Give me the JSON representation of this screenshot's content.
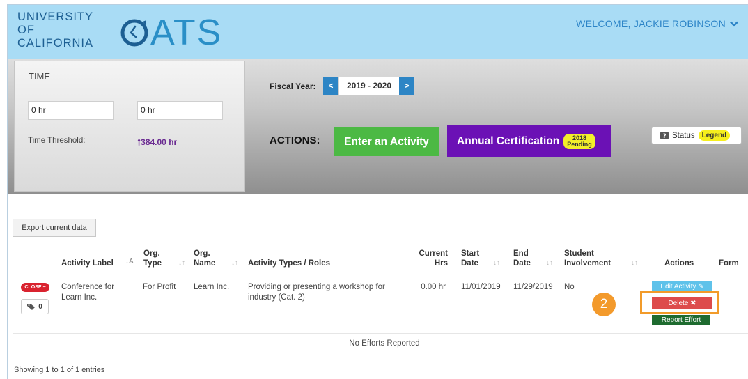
{
  "header": {
    "univ_line1": "UNIVERSITY",
    "univ_line2": "OF",
    "univ_line3": "CALIFORNIA",
    "logo_text": "ATS",
    "welcome": "WELCOME, JACKIE ROBINSON",
    "accent_color": "#2a8fc7"
  },
  "time_panel": {
    "title": "TIME",
    "input1": "0 hr",
    "input2": "0 hr",
    "threshold_label": "Time Threshold:",
    "threshold_value": "384.00 hr"
  },
  "fiscal_year": {
    "label": "Fiscal Year:",
    "prev": "<",
    "value": "2019 - 2020",
    "next": ">"
  },
  "actions": {
    "label": "ACTIONS:",
    "enter_activity": "Enter an Activity",
    "annual_cert": "Annual Certification",
    "cert_badge_line1": "2018",
    "cert_badge_line2": "Pending",
    "status": "Status",
    "legend": "Legend"
  },
  "export_label": "Export current data",
  "table": {
    "headers": {
      "activity_label": "Activity Label",
      "org_type_1": "Org.",
      "org_type_2": "Type",
      "org_name_1": "Org.",
      "org_name_2": "Name",
      "activity_types": "Activity Types / Roles",
      "current_1": "Current",
      "current_2": "Hrs",
      "start_1": "Start",
      "start_2": "Date",
      "end_1": "End",
      "end_2": "Date",
      "student_1": "Student",
      "student_2": "Involvement",
      "actions": "Actions",
      "form": "Form"
    },
    "row": {
      "close_pill": "CLOSE −",
      "tag_count": "0",
      "activity_label_1": "Conference for",
      "activity_label_2": "Learn Inc.",
      "org_type": "For Profit",
      "org_name": "Learn Inc.",
      "activity_type_1": "Providing or presenting a workshop for",
      "activity_type_2": "industry (Cat. 2)",
      "current_hrs": "0.00 hr",
      "start_date": "11/01/2019",
      "end_date": "11/29/2019",
      "student_involvement": "No",
      "edit_btn": "Edit Activity ✎",
      "delete_btn": "Delete ✖",
      "report_btn": "Report Effort"
    },
    "no_efforts": "No Efforts Reported",
    "showing": "Showing 1 to 1 of 1 entries"
  },
  "step_number": "2"
}
